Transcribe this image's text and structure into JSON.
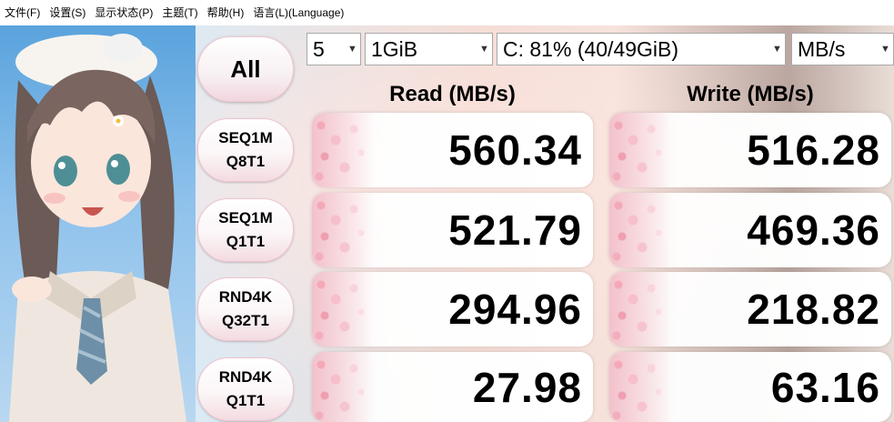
{
  "menu": [
    "文件(F)",
    "设置(S)",
    "显示状态(P)",
    "主题(T)",
    "帮助(H)",
    "语言(L)(Language)"
  ],
  "controls": {
    "all_label": "All",
    "count": "5",
    "size": "1GiB",
    "drive": "C: 81% (40/49GiB)",
    "unit": "MB/s"
  },
  "headers": {
    "read": "Read (MB/s)",
    "write": "Write (MB/s)"
  },
  "tests": [
    {
      "line1": "SEQ1M",
      "line2": "Q8T1",
      "read": "560.34",
      "write": "516.28"
    },
    {
      "line1": "SEQ1M",
      "line2": "Q1T1",
      "read": "521.79",
      "write": "469.36"
    },
    {
      "line1": "RND4K",
      "line2": "Q32T1",
      "read": "294.96",
      "write": "218.82"
    },
    {
      "line1": "RND4K",
      "line2": "Q1T1",
      "read": "27.98",
      "write": "63.16"
    }
  ],
  "colors": {
    "accent_pink": "#f3c1cb",
    "sky_blue": "#6fa3d6"
  }
}
